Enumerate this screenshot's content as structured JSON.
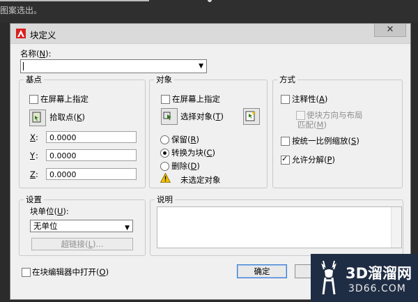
{
  "background": {
    "hint_text": "图案选出。"
  },
  "dialog": {
    "title": "块定义",
    "close_symbol": "✕",
    "name": {
      "label": "名称",
      "hotkey": "N",
      "value": ""
    },
    "base_point": {
      "legend": "基点",
      "specify_on_screen": {
        "label": "在屏幕上指定",
        "checked": false
      },
      "pick_point": {
        "label": "拾取点",
        "hotkey": "K"
      },
      "x": {
        "label": "X",
        "value": "0.0000"
      },
      "y": {
        "label": "Y",
        "value": "0.0000"
      },
      "z": {
        "label": "Z",
        "value": "0.0000"
      }
    },
    "objects": {
      "legend": "对象",
      "specify_on_screen": {
        "label": "在屏幕上指定",
        "checked": false
      },
      "select_objects": {
        "label": "选择对象",
        "hotkey": "T"
      },
      "retain": {
        "label": "保留",
        "hotkey": "R",
        "checked": false
      },
      "convert_to_block": {
        "label": "转换为块",
        "hotkey": "C",
        "checked": true
      },
      "delete": {
        "label": "删除",
        "hotkey": "D",
        "checked": false
      },
      "status": "未选定对象"
    },
    "behavior": {
      "legend": "方式",
      "annotative": {
        "label": "注释性",
        "hotkey": "A",
        "checked": false
      },
      "match_orientation": {
        "label_line1": "使块方向与布局",
        "label_line2": "匹配",
        "hotkey": "M",
        "checked": false,
        "disabled": true
      },
      "scale_uniformly": {
        "label": "按统一比例缩放",
        "hotkey": "S",
        "checked": false
      },
      "allow_exploding": {
        "label": "允许分解",
        "hotkey": "P",
        "checked": true
      }
    },
    "settings": {
      "legend": "设置",
      "block_unit": {
        "label": "块单位",
        "hotkey": "U",
        "value": "无单位"
      },
      "hyperlink": {
        "label": "超链接",
        "hotkey": "L"
      }
    },
    "description": {
      "legend": "说明",
      "value": ""
    },
    "open_in_editor": {
      "label": "在块编辑器中打开",
      "hotkey": "O",
      "checked": false
    },
    "ok_button": {
      "label": "确定"
    }
  },
  "watermark": {
    "line1": "3D溜溜网",
    "line2": "3D66.COM"
  },
  "colors": {
    "accent_red": "#d8201e",
    "dialog_bg": "#f0f0f0",
    "focus_blue": "#3b7bd1",
    "warning_yellow": "#f2c200"
  }
}
